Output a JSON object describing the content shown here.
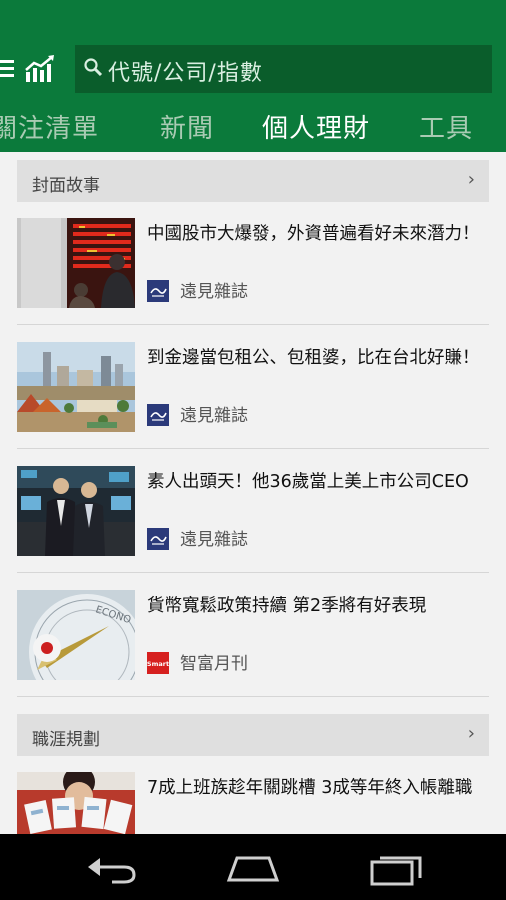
{
  "colors": {
    "brand_green": "#0b7a3b",
    "search_bg": "#0a5d2b",
    "nav_bar": "#000000"
  },
  "header": {
    "menu_icon": "hamburger-menu-icon",
    "logo_icon": "stock-chart-icon",
    "search": {
      "icon": "search-icon",
      "placeholder": "代號/公司/指數"
    }
  },
  "tabs": [
    {
      "label": "關注清單",
      "active": false
    },
    {
      "label": "新聞",
      "active": false
    },
    {
      "label": "個人理財",
      "active": true
    },
    {
      "label": "工具",
      "active": false
    }
  ],
  "sections": [
    {
      "title": "封面故事",
      "chevron": "›",
      "articles": [
        {
          "headline": "中國股市大爆發，外資普遍看好未來潛力！",
          "source": "遠見雜誌",
          "source_logo": "yuanjian-logo-icon"
        },
        {
          "headline": "到金邊當包租公、包租婆，比在台北好賺！",
          "source": "遠見雜誌",
          "source_logo": "yuanjian-logo-icon"
        },
        {
          "headline": "素人出頭天！他36歲當上美上市公司CEO",
          "source": "遠見雜誌",
          "source_logo": "yuanjian-logo-icon"
        },
        {
          "headline": "貨幣寬鬆政策持續 第2季將有好表現",
          "source": "智富月刊",
          "source_logo": "smart-logo-icon",
          "source_logo_text": "Smart"
        }
      ]
    },
    {
      "title": "職涯規劃",
      "chevron": "›",
      "articles": [
        {
          "headline": "7成上班族趁年關跳槽 3成等年終入帳離職"
        }
      ]
    }
  ],
  "thumb_scene_names": {
    "one": "stock-board-photo",
    "two": "city-skyline-photo",
    "three": "businessmen-photo",
    "four": "compass-economy-photo",
    "five": "bonus-envelope-photo"
  },
  "nav_bar": {
    "back": "back-icon",
    "home": "home-icon",
    "recents": "recent-apps-icon"
  },
  "thumb_texts": {
    "compass_word": "ECONO"
  }
}
